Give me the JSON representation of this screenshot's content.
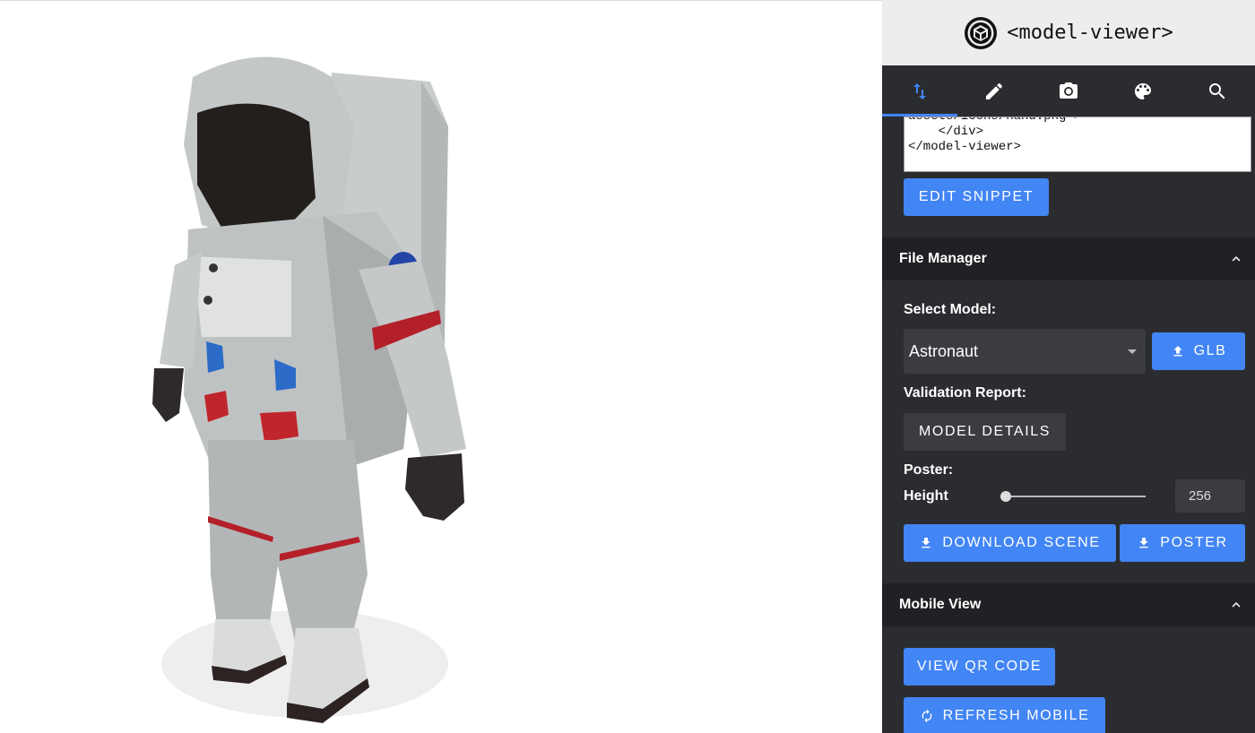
{
  "brand": {
    "title": "<model-viewer>",
    "logo_icon": "model-viewer-cube-icon"
  },
  "tabs": [
    {
      "icon": "swap-vert-icon",
      "active": true
    },
    {
      "icon": "pencil-icon",
      "active": false
    },
    {
      "icon": "camera-icon",
      "active": false
    },
    {
      "icon": "palette-icon",
      "active": false
    },
    {
      "icon": "search-icon",
      "active": false
    }
  ],
  "snippet": {
    "code": "assets/icons/hand.png\">\n    </div>\n</model-viewer>",
    "edit_label": "EDIT SNIPPET"
  },
  "file_manager": {
    "title": "File Manager",
    "select_model_label": "Select Model:",
    "selected_model": "Astronaut",
    "glb_label": "GLB",
    "validation_label": "Validation Report:",
    "model_details_label": "MODEL DETAILS",
    "poster_label": "Poster:",
    "height_label": "Height",
    "height_value": "256",
    "download_scene_label": "DOWNLOAD SCENE",
    "poster_button_label": "POSTER"
  },
  "mobile_view": {
    "title": "Mobile View",
    "qr_label": "VIEW QR CODE",
    "refresh_label": "REFRESH MOBILE"
  },
  "colors": {
    "accent": "#4285f4",
    "panel_bg": "#2b2c30",
    "section_header_bg": "#202124"
  }
}
